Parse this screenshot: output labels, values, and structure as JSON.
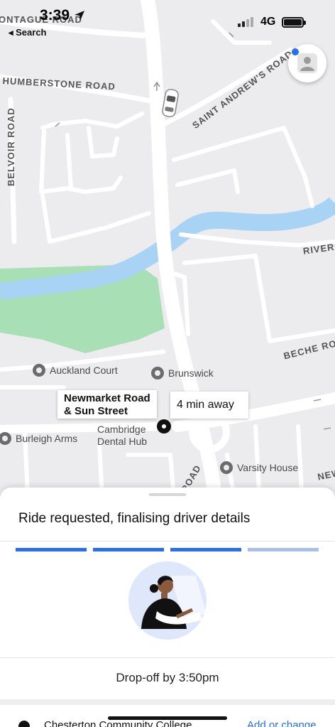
{
  "status_bar": {
    "time": "3:39",
    "back_label": "◂ Search",
    "network": "4G"
  },
  "map": {
    "road_labels": {
      "montague": "ONTAGUE ROAD",
      "humberstone": "HUMBERSTONE ROAD",
      "belvoir": "BELVOIR ROAD",
      "saint_andrews": "SAINT ANDREW'S ROAD",
      "riverside": "RIVERS",
      "beche": "BECHE ROA",
      "road_south": "ROAD",
      "newmarket_edge": "NEW"
    },
    "pois": {
      "auckland": "Auckland Court",
      "brunswick": "Brunswick",
      "burleigh": "Burleigh Arms",
      "dental": "Cambridge Dental Hub",
      "varsity": "Varsity House"
    },
    "pickup_label": "Newmarket Road & Sun Street",
    "eta_label": "4 min away",
    "colors": {
      "land": "#ececee",
      "road": "#ffffff",
      "river": "#a9d3f5",
      "park": "#a8dfb4"
    }
  },
  "profile": {
    "icon": "person-icon"
  },
  "sheet": {
    "title": "Ride requested, finalising driver details",
    "progress_steps_done": 3,
    "progress_steps_total": 4,
    "dropoff": "Drop-off by 3:50pm",
    "destination": "Chesterton Community College",
    "destination_action": "Add or change"
  },
  "colors": {
    "accent": "#276ef1",
    "accent_pending": "#a9bfe9"
  }
}
